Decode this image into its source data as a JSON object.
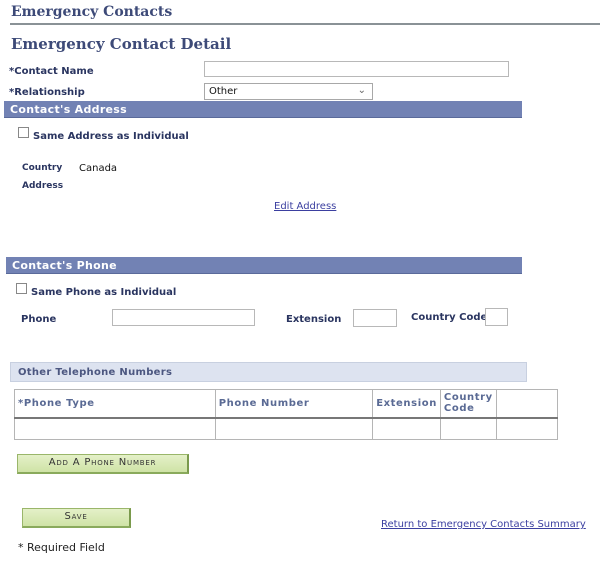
{
  "page_title": "Emergency Contacts",
  "section_title": "Emergency Contact Detail",
  "contact_name": {
    "label": "*Contact Name",
    "value": ""
  },
  "relationship": {
    "label": "*Relationship",
    "selected": "Other"
  },
  "address_section": {
    "title": "Contact's Address",
    "same_as_individual": {
      "label": "Same Address as Individual",
      "checked": false
    },
    "country_label": "Country",
    "country_value": "Canada",
    "address_label": "Address",
    "edit_link": "Edit Address"
  },
  "phone_section": {
    "title": "Contact's Phone",
    "same_as_individual": {
      "label": "Same Phone as Individual",
      "checked": false
    },
    "phone_label": "Phone",
    "phone_value": "",
    "extension_label": "Extension",
    "extension_value": "",
    "country_code_label": "Country Code",
    "country_code_value": ""
  },
  "other_numbers": {
    "title": "Other Telephone Numbers",
    "columns": [
      "*Phone Type",
      "Phone Number",
      "Extension",
      "Country Code",
      ""
    ],
    "column_country_line1": "Country",
    "column_country_line2": "Code",
    "rows": [
      [
        "",
        "",
        "",
        "",
        ""
      ]
    ]
  },
  "buttons": {
    "add_phone": "Add A Phone Number",
    "save": "Save"
  },
  "return_link": "Return to Emergency Contacts Summary",
  "required_note": "* Required Field",
  "colors": {
    "title": "#3d4a78",
    "section_bar": "#7282b4",
    "sub_bar": "#dde3f0",
    "button": "#d6e8b2",
    "link": "#3b3fa0"
  }
}
